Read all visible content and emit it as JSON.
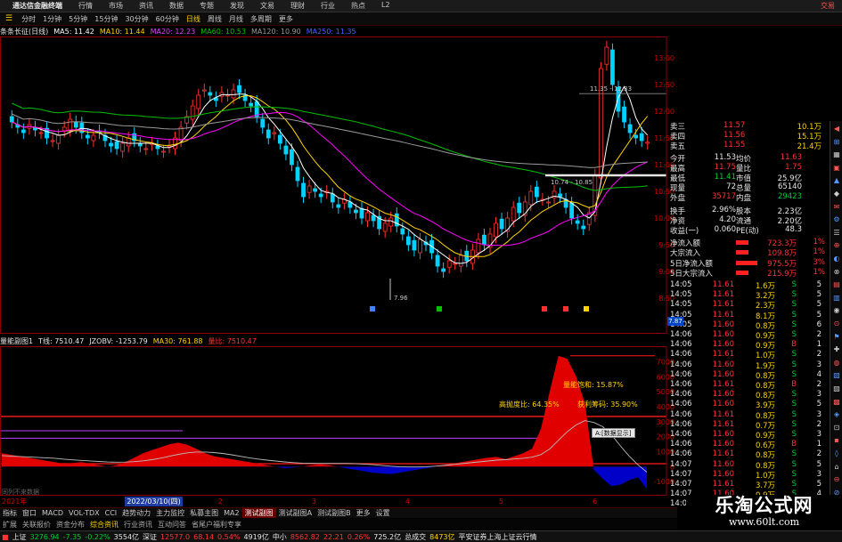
{
  "window": {
    "title": "通达信金融终端",
    "menus": [
      "行情",
      "市场",
      "资讯",
      "数据",
      "专题",
      "发现",
      "文易",
      "理财",
      "行业",
      "热点",
      "L2"
    ],
    "right_label": "交易"
  },
  "periods": [
    "分时",
    "1分钟",
    "5分钟",
    "15分钟",
    "30分钟",
    "60分钟",
    "日线",
    "周线",
    "月线",
    "多周期",
    "更多"
  ],
  "active_period": "日线",
  "ma_legend": {
    "stock": "条条长征(日线)",
    "ma5": "MA5: 11.42",
    "ma10": "MA10: 11.44",
    "ma20": "MA20: 12.23",
    "ma60": "MA60: 10.53",
    "ma120": "MA120: 10.90",
    "ma250": "MA250: 11.35"
  },
  "colors": {
    "up": "#ff3333",
    "down": "#00d2ff",
    "ma5": "#ffffff",
    "ma10": "#ffd400",
    "ma20": "#ff00ff",
    "ma60": "#00c000",
    "ma120": "#9a9a9a",
    "volume_pos": "#e00000",
    "volume_neg": "#0000c8"
  },
  "price_axis": [
    "13.00",
    "12.50",
    "12.00",
    "11.50",
    "11.00",
    "10.50",
    "10.00",
    "9.50",
    "9.00",
    "8.50"
  ],
  "price_annotations": {
    "high": "11.35 - 12.33",
    "low": "10.74 - 10.85",
    "min": "7.96",
    "last_box": "7.87"
  },
  "sub_legend": {
    "name": "量能副图1",
    "t": "T线: 7510.47",
    "jzobv": "JZOBV: -1253.79",
    "ma30": "MA30: 761.88",
    "ref": "量比: 7510.47"
  },
  "sub_axis": [
    "7000",
    "6000",
    "5000",
    "4000",
    "3000",
    "2000",
    "1000",
    "0",
    "-1000"
  ],
  "sub_annotations": {
    "a1": "量能饱和: 15.87%",
    "a2": "高抛度比: 64.35%",
    "a3": "获利筹码: 35.90%",
    "tooltip": "A:[数据显示]"
  },
  "x_labels": {
    "year": "2021年",
    "date": "2022/03/10(四)",
    "nums": [
      "2",
      "3",
      "4",
      "5",
      "6",
      "7"
    ],
    "hint": "同列不来数据"
  },
  "tabs": [
    "指标",
    "窗口",
    "MACD",
    "VOL-TDX",
    "CCI",
    "趋势动力",
    "主力监控",
    "私募主图",
    "MA2",
    "测试副图",
    "测试副图A",
    "测试副图B",
    "更多",
    "设置"
  ],
  "active_tab": "测试副图",
  "bottom_hint": [
    "扩展",
    "关联报价",
    "资金分布",
    "综合资讯",
    "行业资讯",
    "互动问答",
    "省尾户福利专享"
  ],
  "right_panel": {
    "quotes": [
      {
        "label": "卖三",
        "price": "11.57",
        "vol": "10.1万"
      },
      {
        "label": "卖四",
        "price": "11.56",
        "vol": "15.1万"
      },
      {
        "label": "卖五",
        "price": "11.55",
        "vol": "21.4万"
      }
    ],
    "stats": [
      {
        "l1": "今开",
        "v1": "11.53",
        "l2": "均价",
        "v2": "11.63",
        "c1": "wt",
        "c2": "up"
      },
      {
        "l1": "最高",
        "v1": "11.75",
        "l2": "量比",
        "v2": "1.75",
        "c1": "up",
        "c2": "up"
      },
      {
        "l1": "最低",
        "v1": "11.41",
        "l2": "市值",
        "v2": "25.9亿",
        "c1": "dn",
        "c2": "wt"
      },
      {
        "l1": "现量",
        "v1": "72",
        "l2": "总量",
        "v2": "65140",
        "c1": "wt",
        "c2": "wt"
      },
      {
        "l1": "外盘",
        "v1": "35717",
        "l2": "内盘",
        "v2": "29423",
        "c1": "up",
        "c2": "dn"
      }
    ],
    "stats2": [
      {
        "l1": "换手",
        "v1": "2.96%",
        "l2": "股本",
        "v2": "2.23亿"
      },
      {
        "l1": "净资",
        "v1": "4.20",
        "l2": "流通",
        "v2": "2.20亿"
      },
      {
        "l1": "收益(一)",
        "v1": "0.060",
        "l2": "PE(动)",
        "v2": "48.3"
      }
    ],
    "flows": [
      {
        "label": "净流入额",
        "val": "723.3万",
        "pct": "1%"
      },
      {
        "label": "大宗流入",
        "val": "109.8万",
        "pct": "1%"
      },
      {
        "label": "5日净流入额",
        "val": "975.5万",
        "pct": "3%"
      },
      {
        "label": "5日大宗流入",
        "val": "215.9万",
        "pct": "1%"
      }
    ],
    "ticks": [
      {
        "t": "14:05",
        "p": "11.61",
        "v": "1.6万",
        "d": "S",
        "n": "5"
      },
      {
        "t": "14:05",
        "p": "11.61",
        "v": "3.2万",
        "d": "S",
        "n": "5"
      },
      {
        "t": "14:05",
        "p": "11.61",
        "v": "2.3万",
        "d": "S",
        "n": "5"
      },
      {
        "t": "14:05",
        "p": "11.61",
        "v": "8.1万",
        "d": "S",
        "n": "5"
      },
      {
        "t": "14:05",
        "p": "11.60",
        "v": "0.8万",
        "d": "S",
        "n": "6"
      },
      {
        "t": "14:06",
        "p": "11.60",
        "v": "0.9万",
        "d": "S",
        "n": "2"
      },
      {
        "t": "14:06",
        "p": "11.60",
        "v": "0.9万",
        "d": "B",
        "n": "1"
      },
      {
        "t": "14:06",
        "p": "11.61",
        "v": "1.0万",
        "d": "S",
        "n": "2"
      },
      {
        "t": "14:06",
        "p": "11.60",
        "v": "1.9万",
        "d": "S",
        "n": "3"
      },
      {
        "t": "14:06",
        "p": "11.60",
        "v": "0.8万",
        "d": "S",
        "n": "4"
      },
      {
        "t": "14:06",
        "p": "11.61",
        "v": "0.8万",
        "d": "B",
        "n": "2"
      },
      {
        "t": "14:06",
        "p": "11.60",
        "v": "0.8万",
        "d": "S",
        "n": "3"
      },
      {
        "t": "14:06",
        "p": "11.60",
        "v": "3.9万",
        "d": "S",
        "n": "5"
      },
      {
        "t": "14:06",
        "p": "11.61",
        "v": "0.8万",
        "d": "S",
        "n": "3"
      },
      {
        "t": "14:06",
        "p": "11.61",
        "v": "0.7万",
        "d": "S",
        "n": "2"
      },
      {
        "t": "14:06",
        "p": "11.60",
        "v": "0.9万",
        "d": "S",
        "n": "3"
      },
      {
        "t": "14:06",
        "p": "11.60",
        "v": "0.6万",
        "d": "B",
        "n": "1"
      },
      {
        "t": "14:06",
        "p": "11.61",
        "v": "0.8万",
        "d": "S",
        "n": "2"
      },
      {
        "t": "14:07",
        "p": "11.60",
        "v": "0.8万",
        "d": "S",
        "n": "5"
      },
      {
        "t": "14:07",
        "p": "11.60",
        "v": "1.0万",
        "d": "S",
        "n": "3"
      },
      {
        "t": "14:07",
        "p": "11.61",
        "v": "3.7万",
        "d": "S",
        "n": "5"
      },
      {
        "t": "14:07",
        "p": "11.60",
        "v": "0.9万",
        "d": "S",
        "n": "4"
      },
      {
        "t": "14:07",
        "p": "11.60",
        "v": "0.8万",
        "d": "S",
        "n": "3"
      }
    ],
    "tabs_right": "五档|超大"
  },
  "status": {
    "sh_label": "上证",
    "sh_val": "3276.94",
    "sh_chg": "-7.35",
    "sh_pct": "-0.22%",
    "sh_amt": "3554亿",
    "sz_label": "深证",
    "sz_val": "12577.0",
    "sz_chg": "68.14",
    "sz_pct": "0.54%",
    "sz_amt": "4919亿",
    "zx_label": "中小",
    "zx_val": "8562.82",
    "zx_chg": "22.21",
    "zx_pct": "0.26%",
    "zx_amt": "725.2亿",
    "total_label": "总成交",
    "total_val": "8473亿",
    "broker": "平安证券上海上证云行情"
  },
  "watermark": {
    "title": "乐淘公式网",
    "url": "www.60lt.com"
  }
}
